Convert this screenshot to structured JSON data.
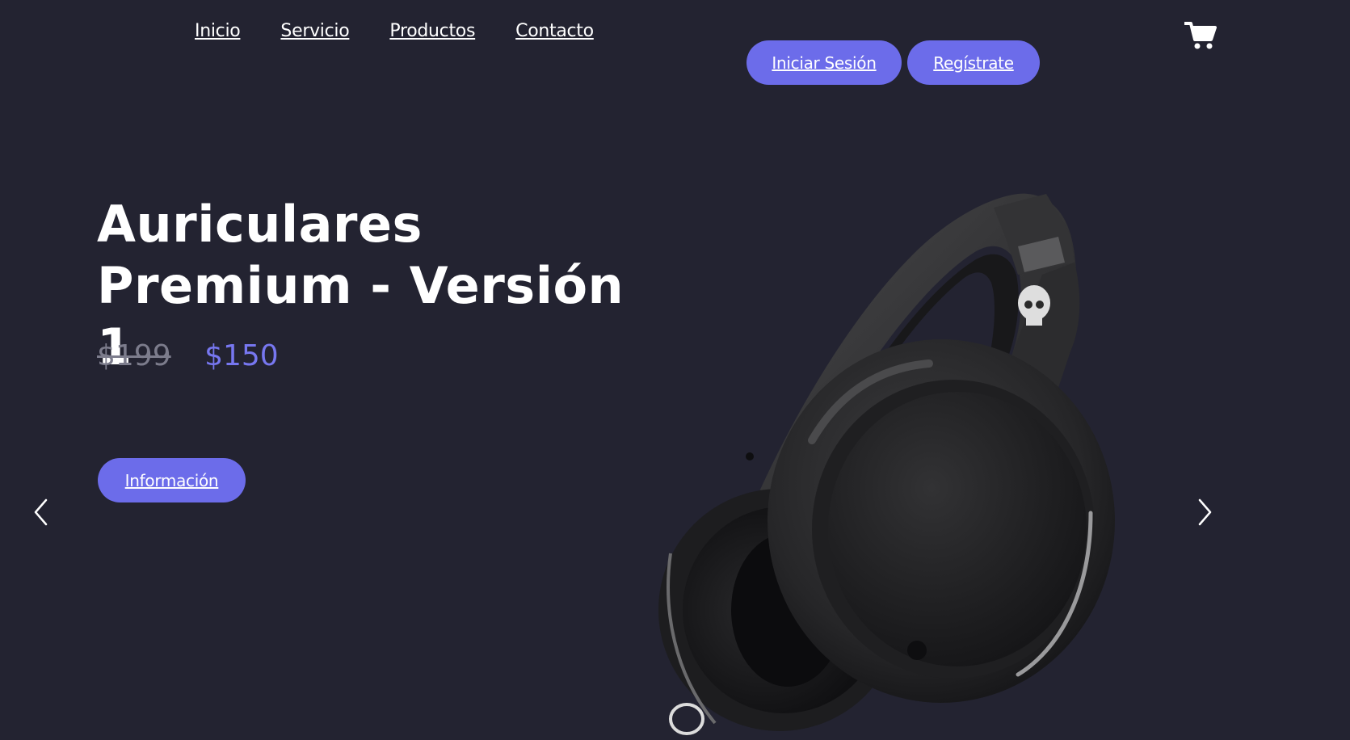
{
  "nav": {
    "items": [
      "Inicio",
      "Servicio",
      "Productos",
      "Contacto"
    ]
  },
  "auth": {
    "login_label": "Iniciar Sesión",
    "register_label": "Regístrate"
  },
  "cart": {
    "icon": "cart-icon"
  },
  "hero": {
    "title_line1": "Auriculares",
    "title_line2": "Premium - Versión 1",
    "old_price": "$199",
    "new_price": "$150",
    "info_label": "Información"
  },
  "carousel": {
    "prev_icon": "chevron-left-icon",
    "next_icon": "chevron-right-icon"
  },
  "product_image": {
    "icon": "headphones-image"
  },
  "colors": {
    "background": "#232331",
    "accent": "#6c6cea",
    "price_accent": "#7777f0",
    "old_price": "#7c7c8c"
  }
}
